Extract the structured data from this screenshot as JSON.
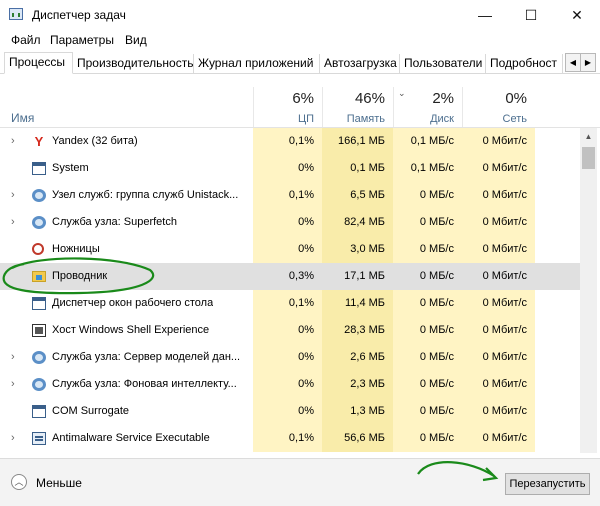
{
  "window": {
    "title": "Диспетчер задач",
    "controls": {
      "minimize": "—",
      "maximize": "☐",
      "close": "✕"
    }
  },
  "menu": [
    "Файл",
    "Параметры",
    "Вид"
  ],
  "tabs": [
    "Процессы",
    "Производительность",
    "Журнал приложений",
    "Автозагрузка",
    "Пользователи",
    "Подробност"
  ],
  "tab_scroll": {
    "left": "◀",
    "right": "▶"
  },
  "columns": {
    "name": "Имя",
    "cpu": {
      "pct": "6%",
      "label": "ЦП"
    },
    "memory": {
      "pct": "46%",
      "label": "Память"
    },
    "disk": {
      "pct": "2%",
      "label": "Диск"
    },
    "network": {
      "pct": "0%",
      "label": "Сеть"
    }
  },
  "processes": [
    {
      "name": "Yandex (32 бита)",
      "expandable": true,
      "icon": "yandex-icon",
      "cpu": "0,1%",
      "memory": "166,1 МБ",
      "disk": "0,1 МБ/с",
      "network": "0 Мбит/с"
    },
    {
      "name": "System",
      "expandable": false,
      "icon": "window-icon",
      "cpu": "0%",
      "memory": "0,1 МБ",
      "disk": "0,1 МБ/с",
      "network": "0 Мбит/с"
    },
    {
      "name": "Узел служб: группа служб Unistack...",
      "expandable": true,
      "icon": "gear-icon",
      "cpu": "0,1%",
      "memory": "6,5 МБ",
      "disk": "0 МБ/с",
      "network": "0 Мбит/с"
    },
    {
      "name": "Служба узла: Superfetch",
      "expandable": true,
      "icon": "gear-icon",
      "cpu": "0%",
      "memory": "82,4 МБ",
      "disk": "0 МБ/с",
      "network": "0 Мбит/с"
    },
    {
      "name": "Ножницы",
      "expandable": false,
      "icon": "scissors-icon",
      "cpu": "0%",
      "memory": "3,0 МБ",
      "disk": "0 МБ/с",
      "network": "0 Мбит/с"
    },
    {
      "name": "Проводник",
      "expandable": false,
      "icon": "folder-icon",
      "cpu": "0,3%",
      "memory": "17,1 МБ",
      "disk": "0 МБ/с",
      "network": "0 Мбит/с",
      "selected": true
    },
    {
      "name": "Диспетчер окон рабочего стола",
      "expandable": false,
      "icon": "window-icon",
      "cpu": "0,1%",
      "memory": "11,4 МБ",
      "disk": "0 МБ/с",
      "network": "0 Мбит/с"
    },
    {
      "name": "Хост Windows Shell Experience",
      "expandable": false,
      "icon": "host-icon",
      "cpu": "0%",
      "memory": "28,3 МБ",
      "disk": "0 МБ/с",
      "network": "0 Мбит/с"
    },
    {
      "name": "Служба узла: Сервер моделей дан...",
      "expandable": true,
      "icon": "gear-icon",
      "cpu": "0%",
      "memory": "2,6 МБ",
      "disk": "0 МБ/с",
      "network": "0 Мбит/с"
    },
    {
      "name": "Служба узла: Фоновая интеллекту...",
      "expandable": true,
      "icon": "gear-icon",
      "cpu": "0%",
      "memory": "2,3 МБ",
      "disk": "0 МБ/с",
      "network": "0 Мбит/с"
    },
    {
      "name": "COM Surrogate",
      "expandable": false,
      "icon": "window-icon",
      "cpu": "0%",
      "memory": "1,3 МБ",
      "disk": "0 МБ/с",
      "network": "0 Мбит/с"
    },
    {
      "name": "Antimalware Service Executable",
      "expandable": true,
      "icon": "shield-icon",
      "cpu": "0,1%",
      "memory": "56,6 МБ",
      "disk": "0 МБ/с",
      "network": "0 Мбит/с"
    }
  ],
  "footer": {
    "less_label": "Меньше",
    "restart_label": "Перезапустить"
  },
  "annotation_color": "#1a8a1a"
}
